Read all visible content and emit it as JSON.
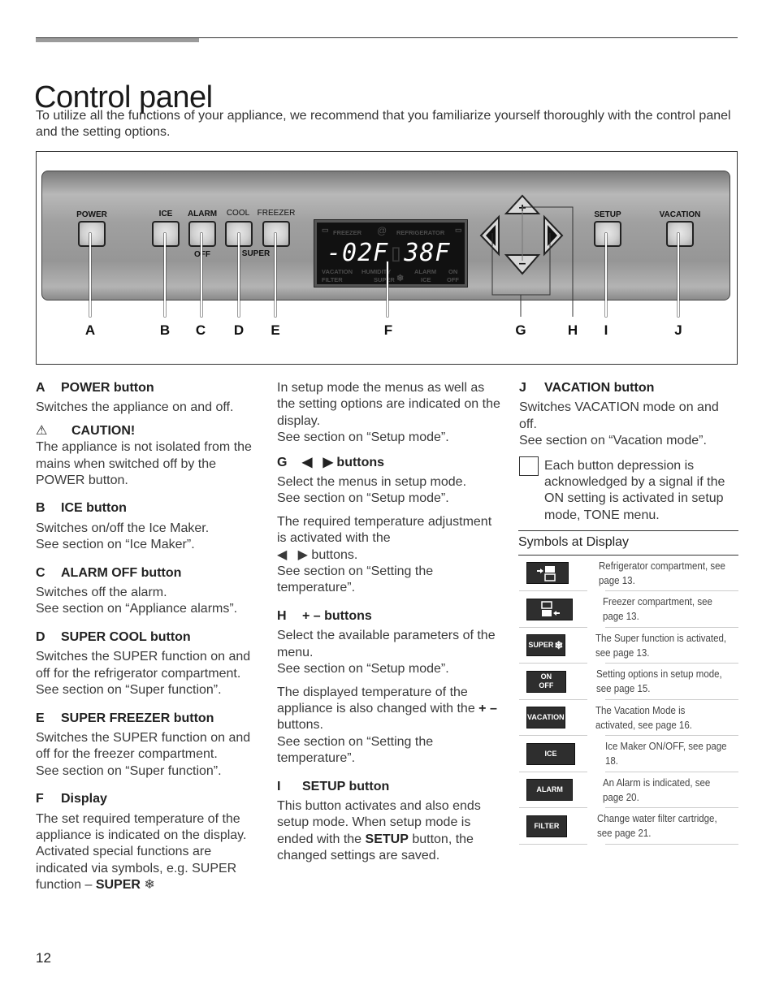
{
  "page": {
    "title": "Control panel",
    "intro": "To utilize all the functions of your appliance, we recommend that you familiarize yourself thoroughly with the control panel and the setting options.",
    "page_number": "12"
  },
  "figure": {
    "panel_labels": {
      "power": "POWER",
      "ice": "ICE",
      "alarm": "ALARM",
      "alarm_sub": "OFF",
      "cool": "COOL",
      "freezer": "FREEZER",
      "super_sub": "SUPER",
      "setup": "SETUP",
      "vacation": "VACATION"
    },
    "display": {
      "freezer_label": "FREEZER",
      "at_symbol": "@",
      "refrigerator_label": "REFRIGERATOR",
      "freezer_temp": "-02F",
      "refrigerator_temp": "38F",
      "bottom_row1": [
        "VACATION",
        "HUMIDITY",
        "ALARM",
        "ON"
      ],
      "bottom_row2": [
        "FILTER",
        "SUPER",
        "ICE",
        "OFF"
      ]
    },
    "callout_letters": [
      "A",
      "B",
      "C",
      "D",
      "E",
      "F",
      "G",
      "H",
      "I",
      "J"
    ]
  },
  "columns": {
    "a": {
      "letter": "A",
      "heading": "POWER button",
      "text": "Switches the appliance on and off."
    },
    "caution": {
      "icon": "warning-triangle",
      "heading": "CAUTION!",
      "text": "The appliance is not isolated from the mains when switched off by the POWER button."
    },
    "b": {
      "letter": "B",
      "heading": "ICE button",
      "text": "Switches on/off the Ice Maker.",
      "ref": "See section on “Ice Maker”."
    },
    "c": {
      "letter": "C",
      "heading": "ALARM OFF button",
      "text": "Switches off the alarm.",
      "ref": "See section on “Appliance alarms”."
    },
    "d": {
      "letter": "D",
      "heading": "SUPER COOL button",
      "text": "Switches the SUPER function on and off for the refrigerator compartment.",
      "ref": "See section on “Super function”."
    },
    "e": {
      "letter": "E",
      "heading": "SUPER FREEZER button",
      "text": "Switches the SUPER function on and off for the freezer compartment.",
      "ref": "See section on “Super function”."
    },
    "f": {
      "letter": "F",
      "heading": "Display",
      "text": "The set required temperature of the appliance is indicated on the display. Activated special functions are indicated via symbols, e.g. SUPER function – ",
      "bold_tail": "SUPER"
    },
    "setup_intro": {
      "text": "In setup mode the menus as well as the setting options are indicated on the display.",
      "ref": "See section on “Setup mode”."
    },
    "g": {
      "letter": "G",
      "heading": "buttons",
      "text": "Select the menus in setup mode.",
      "ref": "See section on “Setup mode”.",
      "text2": "The required temperature adjustment is activated with the",
      "text2_tail": "buttons.",
      "ref2": "See section on “Setting the temperature”."
    },
    "h": {
      "letter": "H",
      "heading": "+ – buttons",
      "text": "Select the available parameters of the menu.",
      "ref": "See section on “Setup mode”.",
      "text2": "The displayed temperature of the appliance is also changed with the",
      "text2_bold": "+ –",
      "text2_tail": "buttons.",
      "ref2": "See section on “Setting the temperature”."
    },
    "i": {
      "letter": "I",
      "heading": "SETUP button",
      "text1": "This button activates and also ends setup mode. When setup mode is ended with the",
      "text_bold": "SETUP",
      "text2": "button, the changed settings are saved."
    },
    "j": {
      "letter": "J",
      "heading": "VACATION button",
      "text": "Switches VACATION mode on and off.",
      "ref": "See section on “Vacation mode”."
    },
    "note": {
      "text": "Each button depression is acknowledged by a signal if the ON setting is activated in setup mode, TONE menu."
    }
  },
  "symbols": {
    "title": "Symbols at Display",
    "rows": [
      {
        "badge": "",
        "icon": "refrigerator-compartment-icon",
        "desc": "Refrigerator compartment, see page 13."
      },
      {
        "badge": "",
        "icon": "freezer-compartment-icon",
        "desc": "Freezer compartment, see page 13."
      },
      {
        "badge": "SUPER",
        "icon": "snowflake-icon",
        "desc": "The Super function is activated, see page 13."
      },
      {
        "badge": "ON OFF",
        "icon": "",
        "desc": "Setting options in setup mode, see page 15."
      },
      {
        "badge": "VACATION",
        "icon": "",
        "desc": "The Vacation Mode is activated, see page 16."
      },
      {
        "badge": "ICE",
        "icon": "",
        "desc": "Ice Maker ON/OFF, see page 18."
      },
      {
        "badge": "ALARM",
        "icon": "",
        "desc": "An Alarm is indicated, see page 20."
      },
      {
        "badge": "FILTER",
        "icon": "",
        "desc": "Change water filter cartridge, see page 21."
      }
    ]
  }
}
